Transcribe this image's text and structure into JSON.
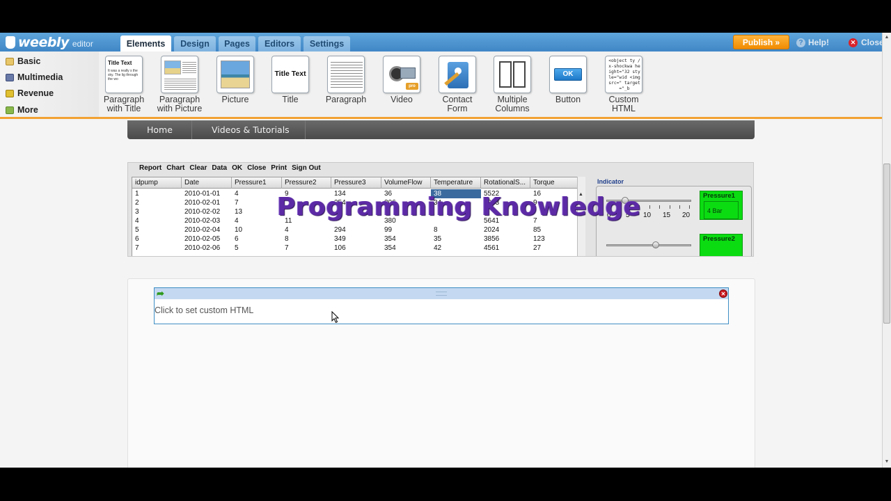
{
  "header": {
    "logo_text": "weebly",
    "logo_sub": "editor",
    "tabs": [
      {
        "label": "Elements"
      },
      {
        "label": "Design"
      },
      {
        "label": "Pages"
      },
      {
        "label": "Editors"
      },
      {
        "label": "Settings"
      }
    ],
    "publish_label": "Publish »",
    "help_label": "Help!",
    "close_label": "Close"
  },
  "categories": [
    {
      "label": "Basic"
    },
    {
      "label": "Multimedia"
    },
    {
      "label": "Revenue"
    },
    {
      "label": "More"
    }
  ],
  "tools": [
    {
      "label": "Paragraph with Title",
      "thumb_title": "Title Text",
      "thumb_text": "It was a really s the sky. The lig through the wo"
    },
    {
      "label": "Paragraph with Picture"
    },
    {
      "label": "Picture"
    },
    {
      "label": "Title",
      "thumb_title": "Title Text"
    },
    {
      "label": "Paragraph"
    },
    {
      "label": "Video"
    },
    {
      "label": "Contact Form"
    },
    {
      "label": "Multiple Columns"
    },
    {
      "label": "Button",
      "thumb_button": "OK"
    },
    {
      "label": "Custom HTML",
      "thumb_code": "<object ty /x-shockwa height=\"32 style=\"wid <img src=\" target=\"_b"
    }
  ],
  "nav": {
    "items": [
      {
        "label": "Home"
      },
      {
        "label": "Videos & Tutorials"
      }
    ]
  },
  "embed": {
    "menu": [
      "Report",
      "Chart",
      "Clear",
      "Data",
      "OK",
      "Close",
      "Print",
      "Sign Out"
    ],
    "columns": [
      "idpump",
      "Date",
      "Pressure1",
      "Pressure2",
      "Pressure3",
      "VolumeFlow",
      "Temperature",
      "RotationalS...",
      "Torque"
    ],
    "rows": [
      [
        "1",
        "2010-01-01",
        "4",
        "9",
        "134",
        "36",
        "38",
        "5522",
        "16"
      ],
      [
        "2",
        "2010-02-01",
        "7",
        "",
        "254",
        "306",
        "34",
        "5933",
        "9"
      ],
      [
        "3",
        "2010-02-02",
        "13",
        "",
        "",
        "",
        "",
        "",
        ""
      ],
      [
        "4",
        "2010-02-03",
        "4",
        "11",
        "",
        "380",
        "",
        "5641",
        "7"
      ],
      [
        "5",
        "2010-02-04",
        "10",
        "4",
        "294",
        "99",
        "8",
        "2024",
        "85"
      ],
      [
        "6",
        "2010-02-05",
        "6",
        "8",
        "349",
        "354",
        "35",
        "3856",
        "123"
      ],
      [
        "7",
        "2010-02-06",
        "5",
        "7",
        "106",
        "354",
        "42",
        "4561",
        "27"
      ]
    ],
    "indicator_title": "Indicator",
    "slider_ticks": [
      "0",
      "5",
      "10",
      "15",
      "20"
    ],
    "pressure1_label": "Pressure1",
    "pressure1_value": "4 Bar",
    "pressure2_label": "Pressure2"
  },
  "watermark": "Programming Knowledge",
  "html_widget": {
    "placeholder": "Click to set custom HTML"
  },
  "colors": {
    "header_blue": "#4a94d2",
    "publish_orange": "#f59a14",
    "panel_accent": "#f2a233",
    "indicator_green": "#0bdc12",
    "watermark_purple": "#5d2aa6"
  }
}
